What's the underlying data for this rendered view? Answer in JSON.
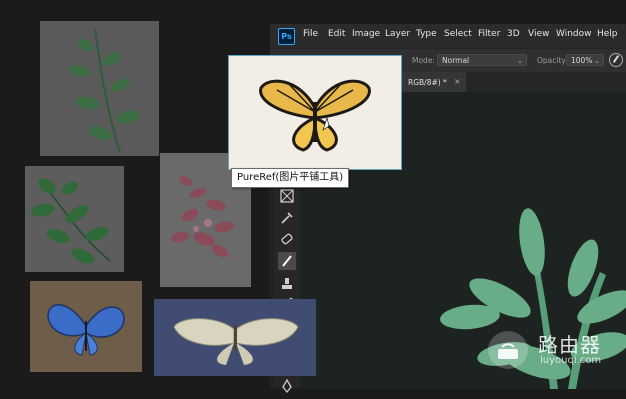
{
  "photoshop": {
    "logo": "Ps",
    "menu": [
      "File",
      "Edit",
      "Image",
      "Layer",
      "Type",
      "Select",
      "Filter",
      "3D",
      "View",
      "Window",
      "Help"
    ],
    "options_bar": {
      "mode_label": "Mode:",
      "mode_value": "Normal",
      "opacity_label": "Opacity:",
      "opacity_value": "100%"
    },
    "document_tab": {
      "title": "RGB/8#) *",
      "close": "×"
    },
    "tools": [
      "frame-tool",
      "eyedropper-tool",
      "healing-brush-tool",
      "brush-tool",
      "clone-stamp-tool",
      "history-brush-tool",
      "eraser-tool",
      "blur-tool",
      "dodge-tool",
      "pen-tool"
    ]
  },
  "pureref": {
    "tooltip": "PureRef(图片平铺工具)",
    "images": [
      "leafy-branch",
      "green-leaves",
      "pink-flower-petals",
      "monarch-butterfly",
      "blue-butterfly",
      "pale-moth"
    ]
  },
  "watermark": {
    "title": "路由器",
    "url": "luyouqi.com"
  },
  "colors": {
    "canvas": "#1d2320",
    "leaf": "#6fb891",
    "accent": "#31a8ff"
  }
}
